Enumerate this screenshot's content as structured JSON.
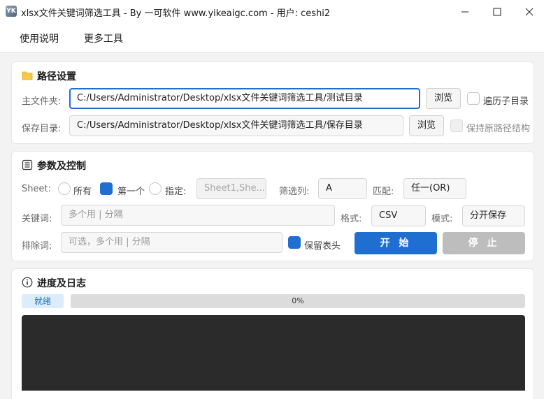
{
  "window": {
    "title": "xlsx文件关键词筛选工具 - By 一可软件 www.yikeaigc.com - 用户: ceshi2",
    "icon_text": "YK"
  },
  "menu": {
    "items": [
      "使用说明",
      "更多工具"
    ]
  },
  "path_settings": {
    "title": "路径设置",
    "main_folder_label": "主文件夹:",
    "main_folder_value": "C:/Users/Administrator/Desktop/xlsx文件关键词筛选工具/测试目录",
    "browse_label": "浏览",
    "recurse_label": "遍历子目录",
    "save_dir_label": "保存目录:",
    "save_dir_value": "C:/Users/Administrator/Desktop/xlsx文件关键词筛选工具/保存目录",
    "keep_structure_label": "保持原路径结构"
  },
  "params": {
    "title": "参数及控制",
    "sheet_label": "Sheet:",
    "sheet_options": [
      "所有",
      "第一个",
      "指定:"
    ],
    "sheet_selected": "第一个",
    "sheet_names_placeholder": "Sheet1,She...",
    "filter_col_label": "筛选列:",
    "filter_col_value": "A",
    "match_label": "匹配:",
    "match_value": "任一(OR)",
    "keyword_label": "关键词:",
    "keyword_placeholder": "多个用 | 分隔",
    "format_label": "格式:",
    "format_value": "CSV",
    "mode_label": "模式:",
    "mode_value": "分开保存",
    "exclude_label": "排除词:",
    "exclude_placeholder": "可选，多个用 | 分隔",
    "keep_header_label": "保留表头",
    "keep_header_checked": true,
    "start_label": "开 始",
    "stop_label": "停 止"
  },
  "progress": {
    "title": "进度及日志",
    "status": "就绪",
    "percent_text": "0%",
    "percent": 0
  },
  "colors": {
    "accent": "#1f6fd1",
    "disabled": "#bdbdbd",
    "log_bg": "#2b2b2b"
  }
}
